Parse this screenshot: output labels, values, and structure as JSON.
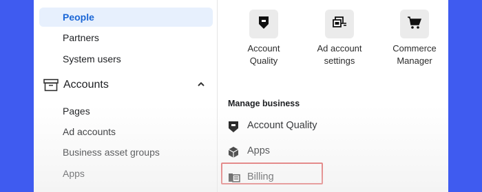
{
  "sidebar": {
    "people_items": [
      "People",
      "Partners",
      "System users"
    ],
    "accounts_section": {
      "label": "Accounts",
      "icon": "archive-box-icon",
      "chevron": "chevron-up-icon"
    },
    "account_items": [
      "Pages",
      "Ad accounts",
      "Business asset groups",
      "Apps"
    ]
  },
  "main": {
    "tools": [
      {
        "label_line1": "Account",
        "label_line2": "Quality",
        "icon": "shield-icon"
      },
      {
        "label_line1": "Ad account",
        "label_line2": "settings",
        "icon": "ad-settings-icon"
      },
      {
        "label_line1": "Commerce",
        "label_line2": "Manager",
        "icon": "shopping-cart-icon"
      }
    ],
    "manage_business": {
      "title": "Manage business",
      "items": [
        {
          "label": "Account Quality",
          "icon": "shield-icon"
        },
        {
          "label": "Apps",
          "icon": "cube-icon"
        },
        {
          "label": "Billing",
          "icon": "billing-icon"
        }
      ]
    }
  },
  "colors": {
    "background": "#3f5bf0",
    "active_nav_bg": "#e7f0fd",
    "active_nav_text": "#1a66d6",
    "highlight_border": "#e05252"
  }
}
